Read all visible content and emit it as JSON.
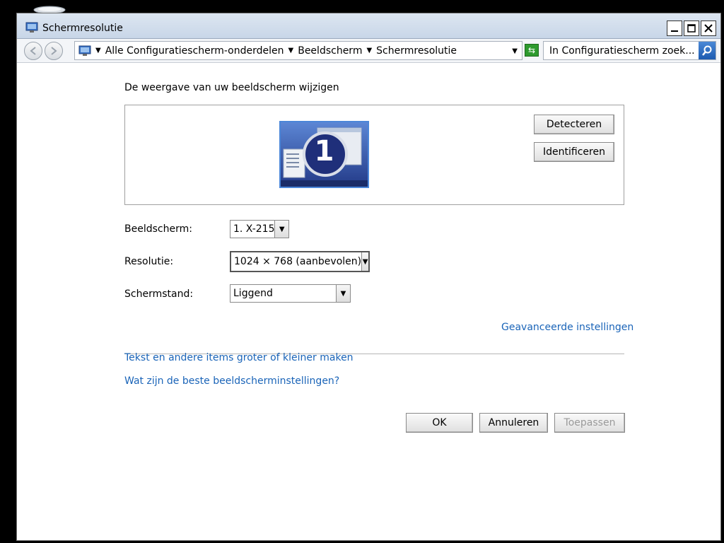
{
  "window": {
    "title": "Schermresolutie"
  },
  "navigation": {
    "breadcrumbs": [
      "Alle Configuratiescherm-onderdelen",
      "Beeldscherm",
      "Schermresolutie"
    ],
    "search_placeholder": "In Configuratiescherm zoek..."
  },
  "main": {
    "heading": "De weergave van uw beeldscherm wijzigen",
    "monitor_number": "1",
    "detect_label": "Detecteren",
    "identify_label": "Identificeren",
    "display_label": "Beeldscherm:",
    "display_value": "1. X-215",
    "resolution_label": "Resolutie:",
    "resolution_value": "1024 × 768 (aanbevolen)",
    "orientation_label": "Schermstand:",
    "orientation_value": "Liggend",
    "advanced_link": "Geavanceerde instellingen",
    "link_text_size": "Tekst en andere items groter of kleiner maken",
    "link_best_settings": "Wat zijn de beste beeldscherminstellingen?"
  },
  "footer": {
    "ok_label": "OK",
    "cancel_label": "Annuleren",
    "apply_label": "Toepassen"
  },
  "colors": {
    "link": "#1a64b8",
    "monitor_blue": "#2b3f8e",
    "refresh_green": "#2e9a2e"
  }
}
